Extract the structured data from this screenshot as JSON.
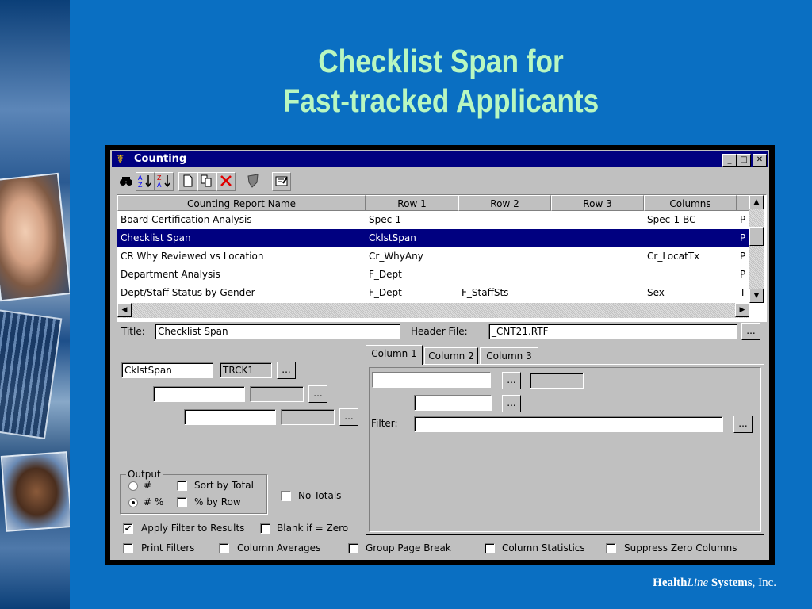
{
  "slide": {
    "title_line1": "Checklist Span for",
    "title_line2": "Fast-tracked Applicants",
    "footer": {
      "brand_a": "Health",
      "brand_b": "Line",
      "brand_c": " Systems",
      "brand_d": ", Inc."
    }
  },
  "window": {
    "title": "Counting",
    "icon": "caduceus-icon",
    "controls": {
      "minimize": "_",
      "maximize": "□",
      "close": "✕"
    }
  },
  "toolbar": {
    "buttons": [
      {
        "name": "find",
        "glyph": "🔍"
      },
      {
        "name": "sort-ascending",
        "glyph": "↓"
      },
      {
        "name": "sort-descending",
        "glyph": "↓"
      },
      {
        "name": "new",
        "glyph": "🗋"
      },
      {
        "name": "copy",
        "glyph": "⎘"
      },
      {
        "name": "delete",
        "glyph": "✕"
      },
      {
        "name": "shield",
        "glyph": "⛊"
      },
      {
        "name": "report",
        "glyph": "▤"
      }
    ]
  },
  "grid": {
    "columns": [
      "Counting Report Name",
      "Row 1",
      "Row 2",
      "Row 3",
      "Columns"
    ],
    "rows": [
      [
        "Board Certification Analysis",
        "Spec-1",
        "",
        "",
        "Spec-1-BC",
        "P"
      ],
      [
        "Checklist Span",
        "CklstSpan",
        "",
        "",
        "",
        "P"
      ],
      [
        "CR Why Reviewed vs Location",
        "Cr_WhyAny",
        "",
        "",
        "Cr_LocatTx",
        "P"
      ],
      [
        "Department Analysis",
        "F_Dept",
        "",
        "",
        "",
        "P"
      ],
      [
        "Dept/Staff Status by Gender",
        "F_Dept",
        "F_StaffSts",
        "",
        "Sex",
        "T"
      ]
    ],
    "selected_row": 1
  },
  "form": {
    "title_label": "Title:",
    "title_value": "Checklist Span",
    "header_file_label": "Header File:",
    "header_file_value": "_CNT21.RTF",
    "ellipsis": "...",
    "row_field1": "CklstSpan",
    "row_field1_code": "TRCK1",
    "tabs": [
      "Column 1",
      "Column 2",
      "Column 3"
    ],
    "filter_label": "Filter:",
    "output_group": "Output",
    "radio_count": "#",
    "radio_count_pct": "# %",
    "sort_by_total": "Sort by Total",
    "pct_by_row": "% by Row",
    "no_totals": "No Totals",
    "apply_filter": "Apply Filter to Results",
    "blank_if_zero": "Blank if = Zero",
    "print_filters": "Print Filters",
    "column_averages": "Column Averages",
    "group_page_break": "Group Page Break",
    "column_statistics": "Column Statistics",
    "suppress_zero_columns": "Suppress Zero Columns",
    "checked_mark": "✔"
  }
}
